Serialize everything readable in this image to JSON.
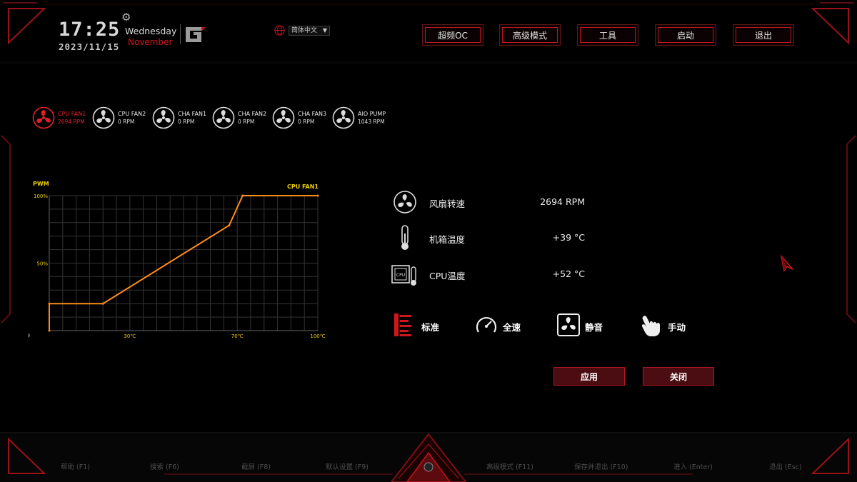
{
  "header": {
    "time": "17:25",
    "date": "2023/11/15",
    "weekday": "Wednesday",
    "month": "November",
    "language": "简体中文",
    "nav": [
      "超频OC",
      "高级模式",
      "工具",
      "启动",
      "退出"
    ]
  },
  "fans": [
    {
      "name": "CPU FAN1",
      "rpm": "2694 RPM",
      "active": true
    },
    {
      "name": "CPU FAN2",
      "rpm": "0 RPM",
      "active": false
    },
    {
      "name": "CHA FAN1",
      "rpm": "0 RPM",
      "active": false
    },
    {
      "name": "CHA FAN2",
      "rpm": "0 RPM",
      "active": false
    },
    {
      "name": "CHA FAN3",
      "rpm": "0 RPM",
      "active": false
    },
    {
      "name": "AIO PUMP",
      "rpm": "1043 RPM",
      "active": false
    }
  ],
  "chart_data": {
    "type": "line",
    "title": "CPU FAN1",
    "ylabel": "PWM",
    "x_ticks": [
      "0",
      "30℃",
      "70℃",
      "100℃"
    ],
    "y_ticks": [
      "100%",
      "50%"
    ],
    "series": [
      {
        "name": "CPU FAN1",
        "x": [
          0,
          0,
          20,
          67,
          72,
          100
        ],
        "y": [
          0,
          20,
          20,
          78,
          100,
          100
        ]
      }
    ],
    "xlim": [
      0,
      100
    ],
    "ylim": [
      0,
      100
    ],
    "grid": true,
    "line_color": "#ff8c1a"
  },
  "stats": [
    {
      "icon": "fan-icon",
      "label": "风扇转速",
      "value": "2694 RPM"
    },
    {
      "icon": "thermometer-icon",
      "label": "机箱温度",
      "value": "+39 °C"
    },
    {
      "icon": "cpu-temp-icon",
      "label": "CPU温度",
      "value": "+52 °C"
    }
  ],
  "modes": [
    {
      "icon": "standard-mode-icon",
      "label": "标准"
    },
    {
      "icon": "full-speed-icon",
      "label": "全速"
    },
    {
      "icon": "silent-fan-icon",
      "label": "静音"
    },
    {
      "icon": "hand-icon",
      "label": "手动"
    }
  ],
  "actions": {
    "apply": "应用",
    "close": "关闭"
  },
  "footer": [
    "帮助 (F1)",
    "搜索 (F6)",
    "截屏 (F8)",
    "默认设置 (F9)",
    "高级模式 (F11)",
    "保存并退出 (F10)",
    "进入 (Enter)",
    "退出 (Esc)"
  ],
  "colors": {
    "accent": "#d0161d",
    "chart_line": "#ff8c1a",
    "chart_text": "#f0d000"
  }
}
